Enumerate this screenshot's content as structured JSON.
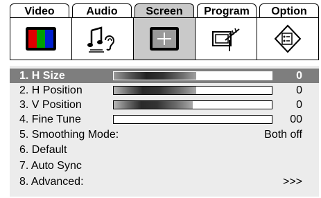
{
  "tabs": [
    {
      "label": "Video",
      "icon": "color-bars-icon",
      "active": false
    },
    {
      "label": "Audio",
      "icon": "music-note-ear-icon",
      "active": false
    },
    {
      "label": "Screen",
      "icon": "crosshair-screen-icon",
      "active": true
    },
    {
      "label": "Program",
      "icon": "tv-antenna-icon",
      "active": false
    },
    {
      "label": "Option",
      "icon": "settings-diamond-icon",
      "active": false
    }
  ],
  "menu": [
    {
      "label": "1. H Size",
      "value": "0",
      "level": 0.52,
      "selected": true
    },
    {
      "label": "2. H Position",
      "value": "0",
      "level": 0.52,
      "selected": false
    },
    {
      "label": "3. V Position",
      "value": "0",
      "level": 0.5,
      "selected": false
    },
    {
      "label": "4. Fine Tune",
      "value": "00",
      "level": 0.0,
      "selected": false
    },
    {
      "label": "5. Smoothing Mode:",
      "value": "Both off",
      "selected": false
    },
    {
      "label": "6. Default",
      "value": "",
      "selected": false
    },
    {
      "label": "7. Auto Sync",
      "value": "",
      "selected": false
    },
    {
      "label": "8. Advanced:",
      "value": ">>>",
      "selected": false
    }
  ],
  "colors": {
    "active_tab": "#c9c9c9",
    "menu_bg": "#ececec",
    "selected_row": "#7e7e7e"
  }
}
